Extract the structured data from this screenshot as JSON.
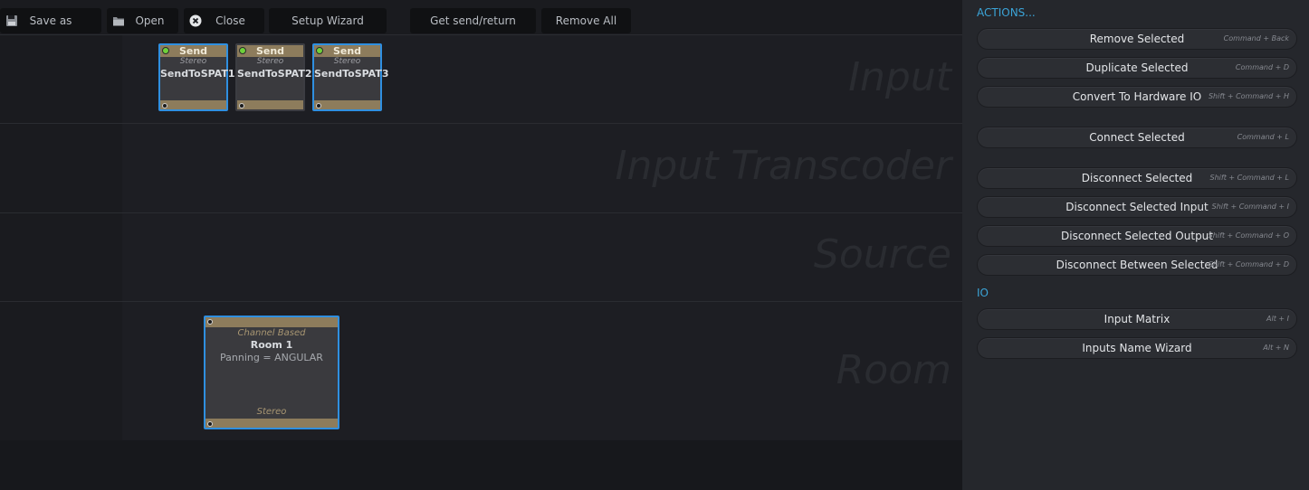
{
  "toolbar": {
    "save_as": "Save as",
    "open": "Open",
    "close": "Close",
    "setup_wizard": "Setup Wizard",
    "get_send_return": "Get send/return",
    "remove_all": "Remove All"
  },
  "lanes": {
    "input": "Input",
    "input_transcoder": "Input Transcoder",
    "source": "Source",
    "room": "Room"
  },
  "send_nodes": [
    {
      "header": "Send",
      "format": "Stereo",
      "name": "SendToSPAT1"
    },
    {
      "header": "Send",
      "format": "Stereo",
      "name": "SendToSPAT2"
    },
    {
      "header": "Send",
      "format": "Stereo",
      "name": "SendToSPAT3"
    }
  ],
  "room_node": {
    "type": "Channel Based",
    "name": "Room 1",
    "panning": "Panning = ANGULAR",
    "format": "Stereo"
  },
  "panel": {
    "actions_title": "ACTIONS...",
    "io_title": "IO",
    "actions": [
      {
        "label": "Remove Selected",
        "shortcut": "Command + Back"
      },
      {
        "label": "Duplicate Selected",
        "shortcut": "Command + D"
      },
      {
        "label": "Convert To Hardware IO",
        "shortcut": "Shift + Command + H"
      },
      {
        "label": "Connect Selected",
        "shortcut": "Command + L"
      },
      {
        "label": "Disconnect Selected",
        "shortcut": "Shift + Command + L"
      },
      {
        "label": "Disconnect Selected Input",
        "shortcut": "Shift + Command + I"
      },
      {
        "label": "Disconnect Selected Output",
        "shortcut": "Shift + Command + O"
      },
      {
        "label": "Disconnect Between Selected",
        "shortcut": "Shift + Command + D"
      }
    ],
    "io": [
      {
        "label": "Input Matrix",
        "shortcut": "Alt + I"
      },
      {
        "label": "Inputs Name Wizard",
        "shortcut": "Alt + N"
      }
    ]
  },
  "colors": {
    "accent": "#2f8fe0",
    "node_header": "#8d7c5c",
    "section_title": "#3ba4d8",
    "led_active": "#6fd13a"
  }
}
